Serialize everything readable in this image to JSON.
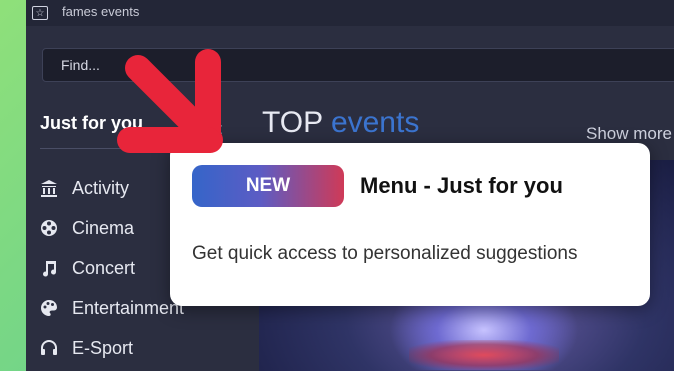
{
  "window": {
    "title": "fames events"
  },
  "search": {
    "placeholder": "Find..."
  },
  "sidebar": {
    "title": "Just for you",
    "items": [
      {
        "label": "Activity",
        "icon": "landmark-icon"
      },
      {
        "label": "Cinema",
        "icon": "film-reel-icon"
      },
      {
        "label": "Concert",
        "icon": "music-note-icon"
      },
      {
        "label": "Entertainment",
        "icon": "palette-icon"
      },
      {
        "label": "E-Sport",
        "icon": "headset-icon"
      }
    ]
  },
  "main": {
    "title_part1": "TOP",
    "title_part2": "events",
    "show_more": "Show more"
  },
  "popup": {
    "badge": "NEW",
    "title": "Menu - Just for you",
    "description": "Get quick access to personalized suggestions"
  },
  "colors": {
    "accent": "#3b74cf",
    "arrow": "#e8253a",
    "window_bg": "#2b2e40"
  }
}
